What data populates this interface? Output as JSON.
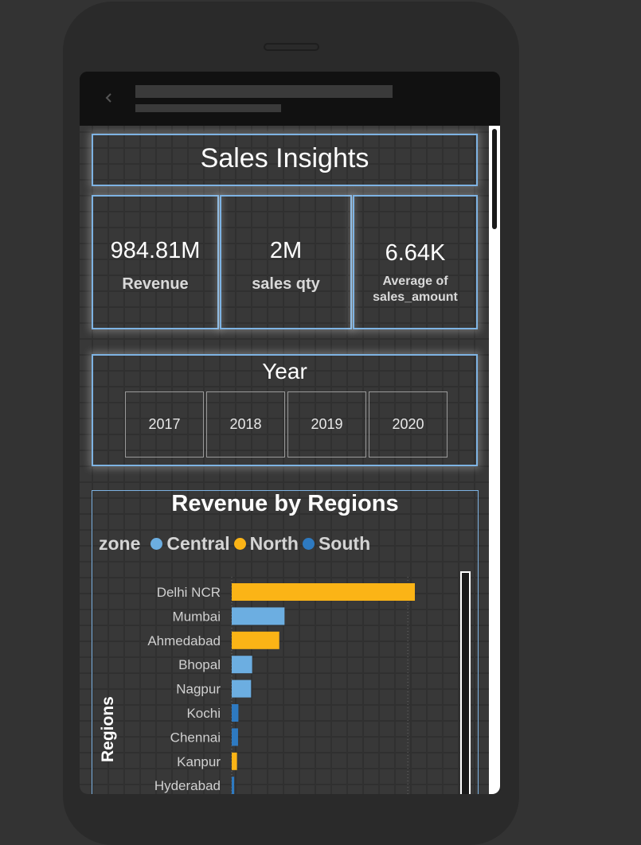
{
  "dashboard": {
    "title": "Sales Insights",
    "kpis": [
      {
        "value": "984.81M",
        "label": "Revenue"
      },
      {
        "value": "2M",
        "label": "sales qty"
      },
      {
        "value": "6.64K",
        "label_line1": "Average of",
        "label_line2": "sales_amount"
      }
    ],
    "year_slicer": {
      "title": "Year",
      "options": [
        "2017",
        "2018",
        "2019",
        "2020"
      ]
    }
  },
  "colors": {
    "background": "#333333",
    "panel_border": "#7eb3e3",
    "central": "#6caee1",
    "north": "#fbb416",
    "south": "#2e7ac1"
  },
  "icons": {
    "back": "chevron-left-icon"
  },
  "chart_data": {
    "type": "bar",
    "orientation": "horizontal",
    "title": "Revenue by Regions",
    "legend_title": "zone",
    "legend_position": "top-left",
    "ylabel": "Regions",
    "xlabel": "",
    "grid": true,
    "unit_note": "values estimated in millions of revenue",
    "xlim": [
      0,
      1000
    ],
    "series": [
      {
        "name": "Central",
        "color": "#6caee1"
      },
      {
        "name": "North",
        "color": "#fbb416"
      },
      {
        "name": "South",
        "color": "#2e7ac1"
      }
    ],
    "categories": [
      "Delhi NCR",
      "Mumbai",
      "Ahmedabad",
      "Bhopal",
      "Nagpur",
      "Kochi",
      "Chennai",
      "Kanpur",
      "Hyderabad"
    ],
    "zones": [
      "North",
      "Central",
      "North",
      "Central",
      "Central",
      "South",
      "South",
      "North",
      "South"
    ],
    "values": [
      520,
      150,
      135,
      58,
      55,
      19,
      18,
      15,
      7
    ]
  }
}
